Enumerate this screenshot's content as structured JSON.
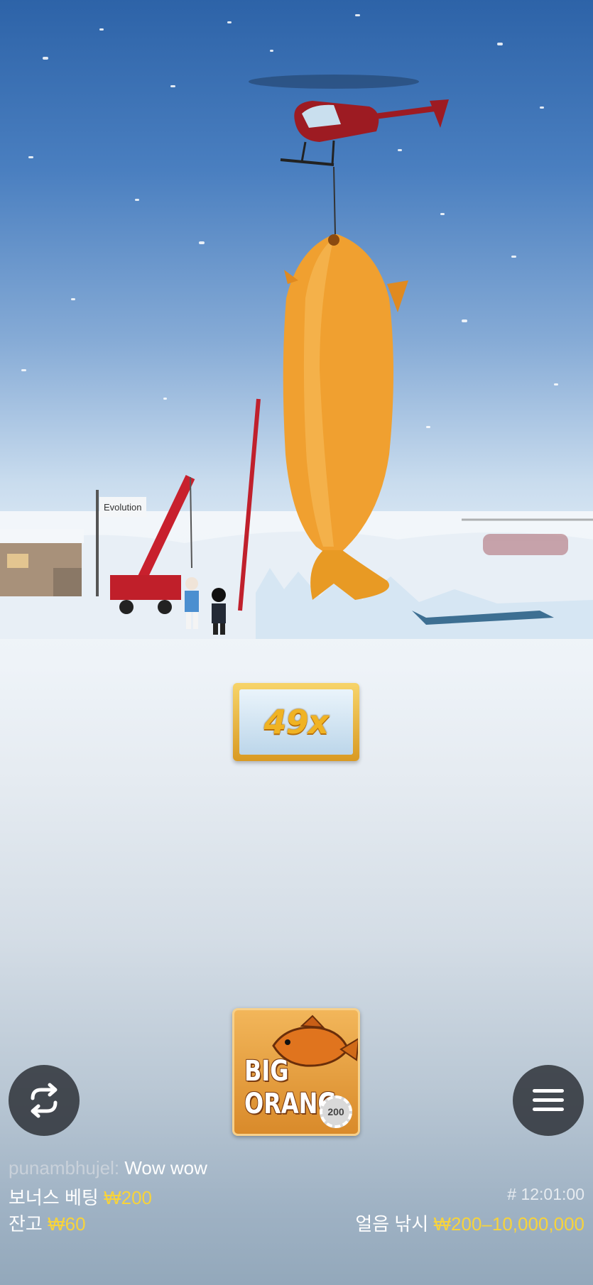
{
  "multiplier": {
    "value": "49x"
  },
  "logo": {
    "line1": "BIG",
    "line2": "ORANG",
    "chip": "200"
  },
  "chat": {
    "user": "punambhujel:",
    "message": "Wow wow"
  },
  "bonus_bet": {
    "label": "보너스 베팅",
    "value": "₩200"
  },
  "balance": {
    "label": "잔고",
    "value": "₩60"
  },
  "round": {
    "id": "# 12:01:00"
  },
  "game": {
    "label": "얼음 낚시",
    "limits": "₩200–10,000,000"
  },
  "flag": {
    "text": "Evolution"
  },
  "icons": {
    "left_button": "repeat-icon",
    "right_button": "menu-icon"
  },
  "colors": {
    "accent_yellow": "#f7d33b",
    "fish_orange": "#f0a030"
  }
}
